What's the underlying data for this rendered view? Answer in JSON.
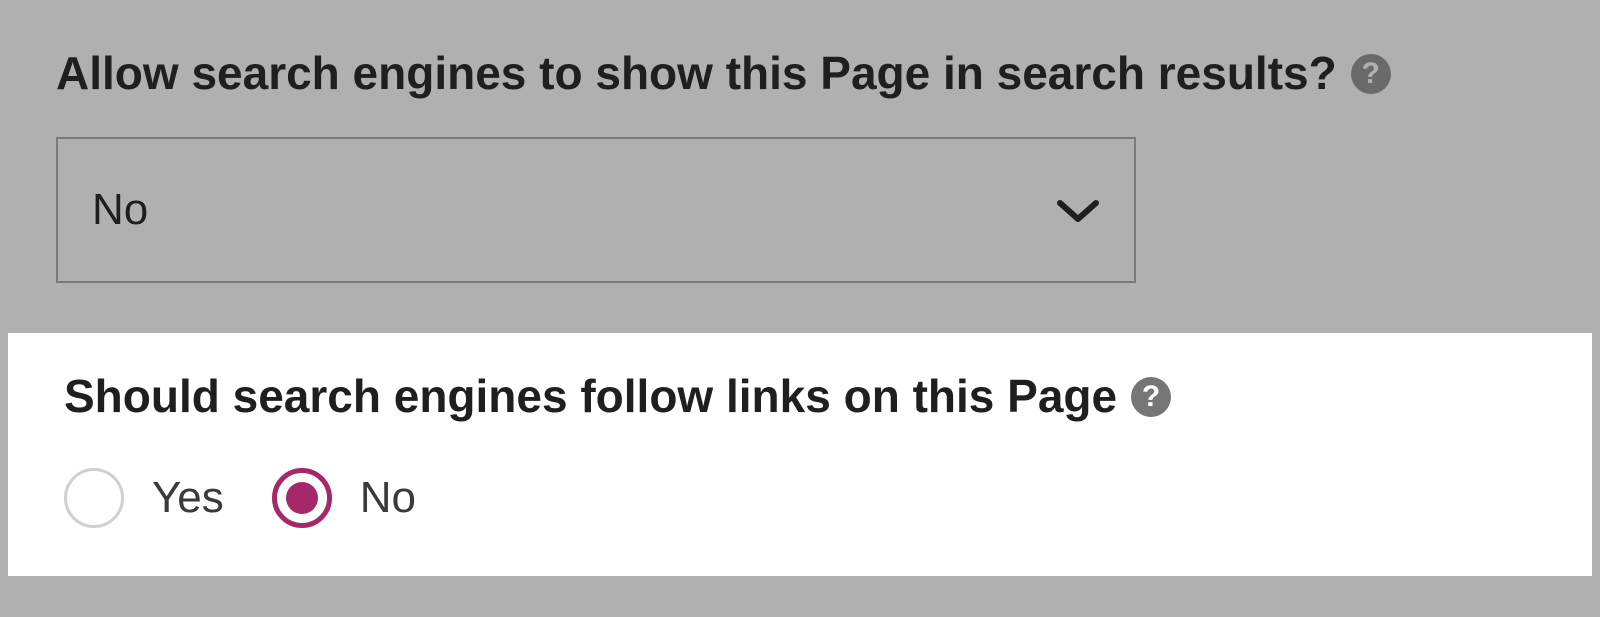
{
  "allow_search": {
    "label": "Allow search engines to show this Page in search results?",
    "selected": "No"
  },
  "follow_links": {
    "label": "Should search engines follow links on this Page",
    "options": {
      "yes": "Yes",
      "no": "No"
    },
    "selected": "no"
  }
}
